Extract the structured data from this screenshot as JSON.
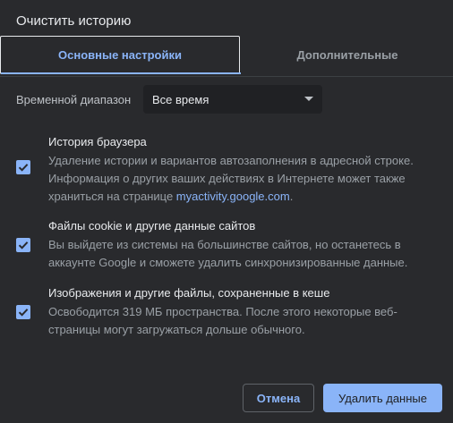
{
  "dialog": {
    "title": "Очистить историю"
  },
  "tabs": [
    {
      "label": "Основные настройки",
      "active": true
    },
    {
      "label": "Дополнительные",
      "active": false
    }
  ],
  "time_range": {
    "label": "Временной диапазон",
    "selected": "Все время"
  },
  "options": [
    {
      "title": "История браузера",
      "description": "Удаление истории и вариантов автозаполнения в адресной строке. Информация о других ваших действиях в Интернете может также храниться на странице ",
      "link": "myactivity.google.com",
      "suffix": ".",
      "checked": true
    },
    {
      "title": "Файлы cookie и другие данные сайтов",
      "description": "Вы выйдете из системы на большинстве сайтов, но останетесь в аккаунте Google и сможете удалить синхронизированные данные.",
      "checked": true
    },
    {
      "title": "Изображения и другие файлы, сохраненные в кеше",
      "description": "Освободится 319 МБ пространства. После этого некоторые веб-страницы могут загружаться дольше обычного.",
      "checked": true
    }
  ],
  "buttons": {
    "cancel": "Отмена",
    "confirm": "Удалить данные"
  },
  "colors": {
    "background": "#292a2d",
    "accent": "#8ab4f8",
    "text": "#e8eaed",
    "secondary_text": "#9aa0a6"
  }
}
